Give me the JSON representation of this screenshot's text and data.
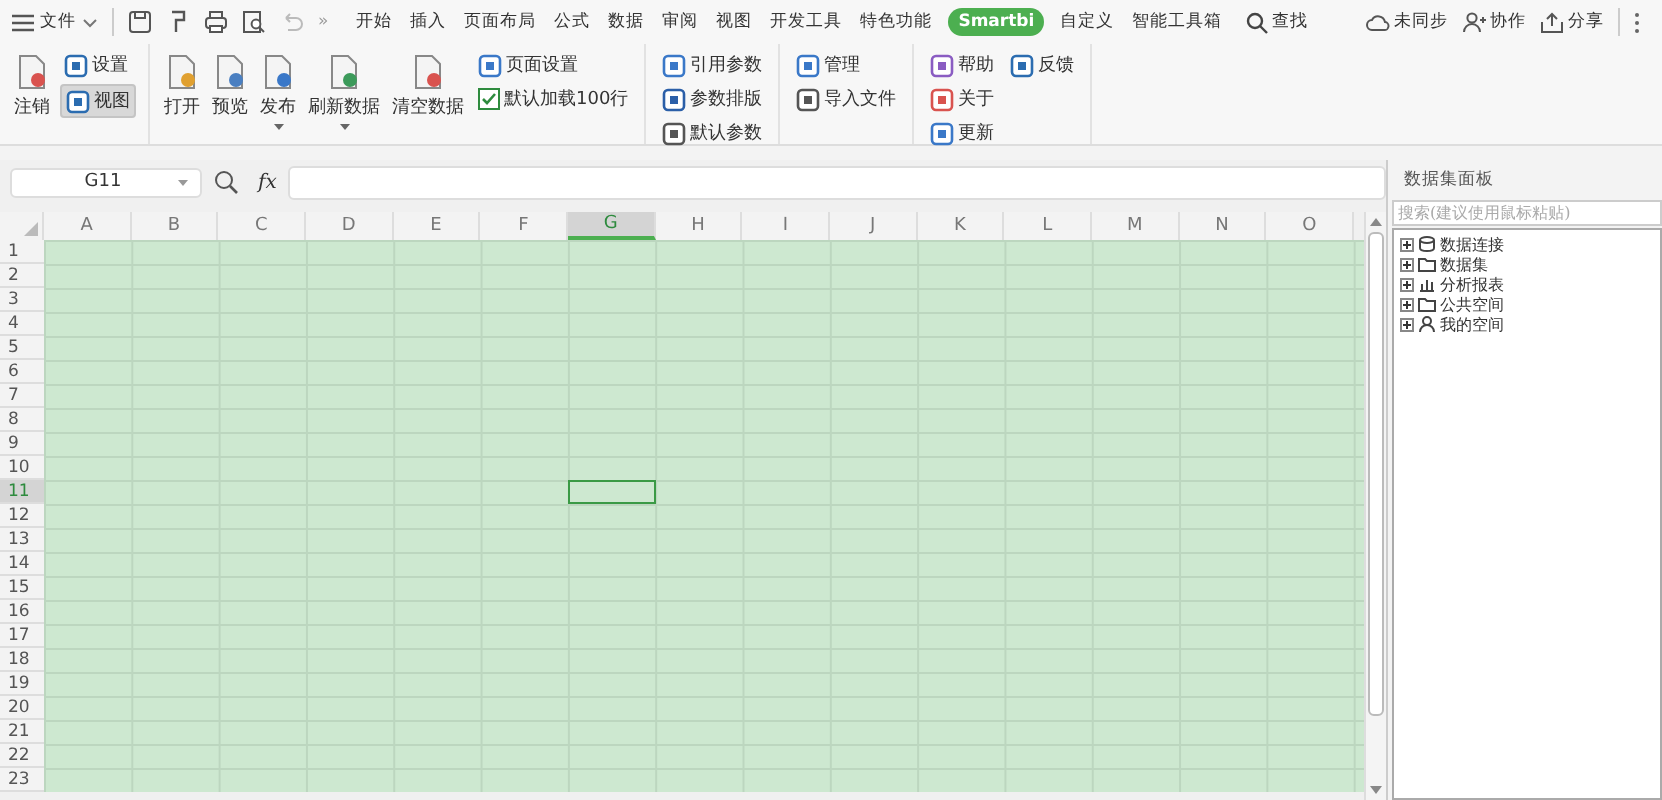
{
  "menu_bar": {
    "file_menu": "文件",
    "more": "»",
    "tabs": [
      {
        "label": "开始",
        "selected": false
      },
      {
        "label": "插入",
        "selected": false
      },
      {
        "label": "页面布局",
        "selected": false
      },
      {
        "label": "公式",
        "selected": false
      },
      {
        "label": "数据",
        "selected": false
      },
      {
        "label": "审阅",
        "selected": false
      },
      {
        "label": "视图",
        "selected": false
      },
      {
        "label": "开发工具",
        "selected": false
      },
      {
        "label": "特色功能",
        "selected": false
      },
      {
        "label": "Smartbi",
        "selected": true
      },
      {
        "label": "自定义",
        "selected": false
      },
      {
        "label": "智能工具箱",
        "selected": false
      }
    ],
    "search": "查找",
    "actions": [
      {
        "kind": "cloud",
        "label": "未同步"
      },
      {
        "kind": "person",
        "label": "协作"
      },
      {
        "kind": "share",
        "label": "分享"
      }
    ]
  },
  "ribbon": {
    "groups": [
      {
        "columns": [
          [
            {
              "kind": "big",
              "label": "注销"
            }
          ],
          [
            {
              "kind": "small",
              "label": "设置",
              "pressed": false
            },
            {
              "kind": "small",
              "label": "视图",
              "pressed": true
            }
          ]
        ]
      },
      {
        "columns": [
          [
            {
              "kind": "big",
              "label": "打开"
            }
          ],
          [
            {
              "kind": "big",
              "label": "预览"
            }
          ],
          [
            {
              "kind": "big",
              "label": "发布",
              "caret": true
            }
          ],
          [
            {
              "kind": "big",
              "label": "刷新数据",
              "caret": true
            }
          ],
          [
            {
              "kind": "big",
              "label": "清空数据"
            }
          ],
          [
            {
              "kind": "small",
              "label": "页面设置"
            },
            {
              "kind": "check",
              "label": "默认加载100行",
              "checked": true
            }
          ]
        ]
      },
      {
        "columns": [
          [
            {
              "kind": "small",
              "label": "引用参数"
            },
            {
              "kind": "small",
              "label": "参数排版"
            },
            {
              "kind": "small",
              "label": "默认参数"
            }
          ]
        ]
      },
      {
        "columns": [
          [
            {
              "kind": "small",
              "label": "管理"
            },
            {
              "kind": "small",
              "label": "导入文件"
            }
          ]
        ]
      },
      {
        "columns": [
          [
            {
              "kind": "small",
              "label": "帮助"
            },
            {
              "kind": "small",
              "label": "关于"
            },
            {
              "kind": "small",
              "label": "更新"
            }
          ],
          [
            {
              "kind": "small",
              "label": "反馈"
            }
          ]
        ]
      }
    ]
  },
  "formula_bar": {
    "name_box": "G11",
    "fx": "fx"
  },
  "sheet": {
    "columns": [
      {
        "label": "A",
        "selected": false
      },
      {
        "label": "B",
        "selected": false
      },
      {
        "label": "C",
        "selected": false
      },
      {
        "label": "D",
        "selected": false
      },
      {
        "label": "E",
        "selected": false
      },
      {
        "label": "F",
        "selected": false
      },
      {
        "label": "G",
        "selected": true
      },
      {
        "label": "H",
        "selected": false
      },
      {
        "label": "I",
        "selected": false
      },
      {
        "label": "J",
        "selected": false
      },
      {
        "label": "K",
        "selected": false
      },
      {
        "label": "L",
        "selected": false
      },
      {
        "label": "M",
        "selected": false
      },
      {
        "label": "N",
        "selected": false
      },
      {
        "label": "O",
        "selected": false
      }
    ],
    "rows": [
      {
        "label": "1",
        "selected": false
      },
      {
        "label": "2",
        "selected": false
      },
      {
        "label": "3",
        "selected": false
      },
      {
        "label": "4",
        "selected": false
      },
      {
        "label": "5",
        "selected": false
      },
      {
        "label": "6",
        "selected": false
      },
      {
        "label": "7",
        "selected": false
      },
      {
        "label": "8",
        "selected": false
      },
      {
        "label": "9",
        "selected": false
      },
      {
        "label": "10",
        "selected": false
      },
      {
        "label": "11",
        "selected": true
      },
      {
        "label": "12",
        "selected": false
      },
      {
        "label": "13",
        "selected": false
      },
      {
        "label": "14",
        "selected": false
      },
      {
        "label": "15",
        "selected": false
      },
      {
        "label": "16",
        "selected": false
      },
      {
        "label": "17",
        "selected": false
      },
      {
        "label": "18",
        "selected": false
      },
      {
        "label": "19",
        "selected": false
      },
      {
        "label": "20",
        "selected": false
      },
      {
        "label": "21",
        "selected": false
      },
      {
        "label": "22",
        "selected": false
      },
      {
        "label": "23",
        "selected": false
      }
    ]
  },
  "dataset_panel": {
    "title": "数据集面板",
    "search": {
      "placeholder": "搜索(建议使用鼠标粘贴)"
    },
    "tree": [
      {
        "label": "数据连接",
        "expanded": false
      },
      {
        "label": "数据集",
        "expanded": false
      },
      {
        "label": "分析报表",
        "expanded": false
      },
      {
        "label": "公共空间",
        "expanded": false
      },
      {
        "label": "我的空间",
        "expanded": false
      }
    ]
  }
}
